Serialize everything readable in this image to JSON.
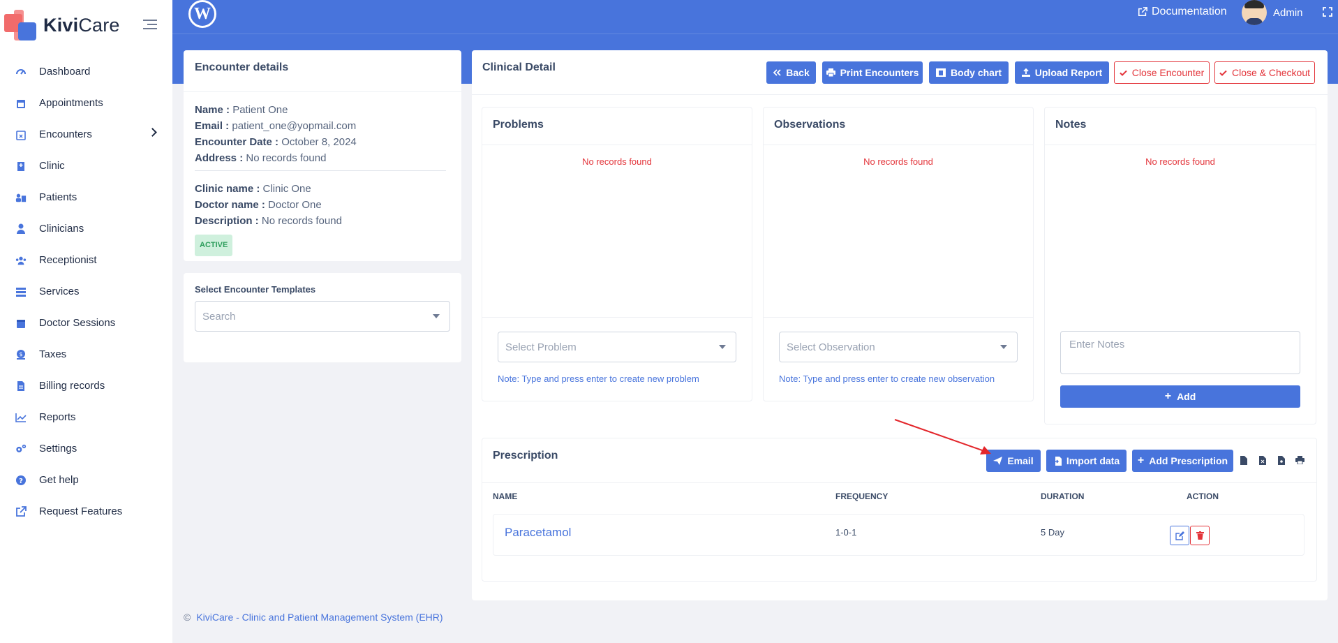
{
  "brand": {
    "name_bold": "Kivi",
    "name_light": "Care"
  },
  "sidebar": {
    "items": [
      {
        "label": "Dashboard",
        "icon": "dashboard-icon"
      },
      {
        "label": "Appointments",
        "icon": "calendar-icon"
      },
      {
        "label": "Encounters",
        "icon": "calendar-x-icon"
      },
      {
        "label": "Clinic",
        "icon": "hospital-icon"
      },
      {
        "label": "Patients",
        "icon": "patients-icon"
      },
      {
        "label": "Clinicians",
        "icon": "doctor-icon"
      },
      {
        "label": "Receptionist",
        "icon": "users-icon"
      },
      {
        "label": "Services",
        "icon": "list-icon"
      },
      {
        "label": "Doctor Sessions",
        "icon": "calendar-icon"
      },
      {
        "label": "Taxes",
        "icon": "money-icon"
      },
      {
        "label": "Billing records",
        "icon": "file-invoice-icon"
      },
      {
        "label": "Reports",
        "icon": "chart-line-icon"
      },
      {
        "label": "Settings",
        "icon": "gears-icon"
      },
      {
        "label": "Get help",
        "icon": "question-circle-icon"
      },
      {
        "label": "Request Features",
        "icon": "external-link-icon"
      }
    ]
  },
  "header": {
    "documentation": "Documentation",
    "user": "Admin"
  },
  "encounter": {
    "title": "Encounter details",
    "name_label": "Name :",
    "name": "Patient One",
    "email_label": "Email :",
    "email": "patient_one@yopmail.com",
    "date_label": "Encounter Date :",
    "date": "October 8, 2024",
    "address_label": "Address :",
    "address": "No records found",
    "clinic_label": "Clinic name :",
    "clinic": "Clinic One",
    "doctor_label": "Doctor name :",
    "doctor": "Doctor One",
    "desc_label": "Description :",
    "desc": "No records found",
    "status": "ACTIVE"
  },
  "templates": {
    "label": "Select Encounter Templates",
    "placeholder": "Search"
  },
  "clinical": {
    "title": "Clinical Detail",
    "buttons": {
      "back": "Back",
      "print": "Print Encounters",
      "body_chart": "Body chart",
      "upload": "Upload Report",
      "close_encounter": "Close Encounter",
      "close_checkout": "Close & Checkout"
    },
    "problems": {
      "title": "Problems",
      "empty": "No records found",
      "placeholder": "Select Problem",
      "note": "Note: Type and press enter to create new problem"
    },
    "observations": {
      "title": "Observations",
      "empty": "No records found",
      "placeholder": "Select Observation",
      "note": "Note: Type and press enter to create new observation"
    },
    "notes": {
      "title": "Notes",
      "empty": "No records found",
      "placeholder": "Enter Notes",
      "add": "Add"
    }
  },
  "prescription": {
    "title": "Prescription",
    "buttons": {
      "email": "Email",
      "import": "Import data",
      "add": "Add Prescription"
    },
    "columns": {
      "name": "NAME",
      "frequency": "FREQUENCY",
      "duration": "DURATION",
      "action": "ACTION"
    },
    "rows": [
      {
        "name": "Paracetamol",
        "frequency": "1-0-1",
        "duration": "5 Day"
      }
    ]
  },
  "footer": {
    "copy": "©",
    "text": "KiviCare - Clinic and Patient Management System (EHR)"
  },
  "colors": {
    "primary": "#4874dc",
    "danger": "#e3343a",
    "success_bg": "#cff0dd"
  }
}
